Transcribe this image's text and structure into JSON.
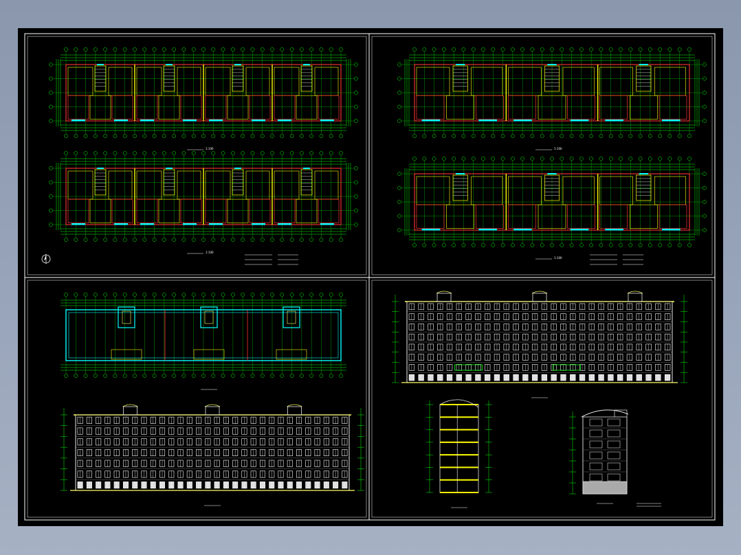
{
  "viewer": {
    "background_color": "#8e9bb0",
    "sheet_color": "#000000"
  },
  "sheet": {
    "frame_color": "#ffffff",
    "colors": {
      "grid": "#00ff00",
      "wall": "#ff3333",
      "wall_inner": "#ffff00",
      "window": "#00ffff",
      "facade": "#e8e8e8",
      "accent": "#ffff66"
    },
    "panels": [
      {
        "id": "plan-1",
        "caption": "",
        "scale": "1:100"
      },
      {
        "id": "plan-2",
        "caption": "",
        "scale": "1:100"
      },
      {
        "id": "plan-3",
        "caption": "",
        "scale": "1:100"
      },
      {
        "id": "plan-4",
        "caption": "",
        "scale": "1:100"
      },
      {
        "id": "roof-plan",
        "caption": "",
        "scale": "1:100"
      },
      {
        "id": "front-elevation",
        "caption": "",
        "scale": "1:100"
      },
      {
        "id": "rear-elevation",
        "caption": "",
        "scale": "1:100"
      },
      {
        "id": "section",
        "caption": "",
        "scale": "1:100"
      },
      {
        "id": "side-elevation",
        "caption": "",
        "scale": "1:100"
      }
    ],
    "north_arrow": "north-arrow-icon"
  }
}
